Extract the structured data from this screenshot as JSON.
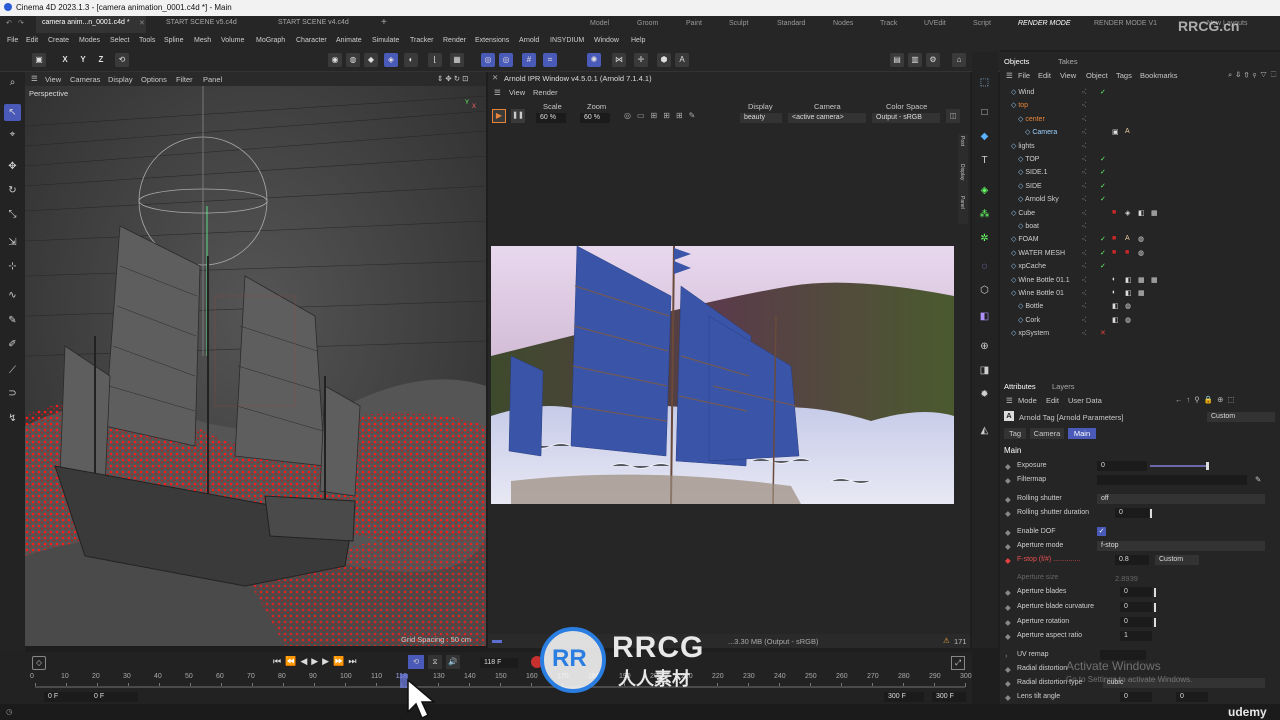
{
  "app": {
    "title": "Cinema 4D 2023.1.3 - [camera animation_0001.c4d *] - Main"
  },
  "tabs": [
    "camera anim...n_0001.c4d *",
    "START SCENE v5.c4d",
    "START SCENE v4.c4d"
  ],
  "layouts": [
    "Model",
    "Groom",
    "Paint",
    "Sculpt",
    "Standard",
    "Nodes",
    "Track",
    "UVEdit",
    "Script",
    "RENDER MODE",
    "RENDER MODE V1"
  ],
  "new_layouts": "New Layouts",
  "menus": [
    "File",
    "Edit",
    "Create",
    "Modes",
    "Select",
    "Tools",
    "Spline",
    "Mesh",
    "Volume",
    "MoGraph",
    "Character",
    "Animate",
    "Simulate",
    "Tracker",
    "Render",
    "Extensions",
    "Arnold",
    "INSYDIUM",
    "Window",
    "Help"
  ],
  "axes": [
    "X",
    "Y",
    "Z"
  ],
  "viewport": {
    "menus": [
      "View",
      "Cameras",
      "Display",
      "Options",
      "Filter",
      "Panel"
    ],
    "label": "Perspective",
    "grid_spacing": "Grid Spacing : 50 cm"
  },
  "ipr": {
    "title": "Arnold IPR Window v4.5.0.1 (Arnold 7.1.4.1)",
    "menus": [
      "View",
      "Render"
    ],
    "scale_label": "Scale",
    "scale": "60 %",
    "zoom_label": "Zoom",
    "zoom": "60 %",
    "display_label": "Display",
    "display": "beauty",
    "camera_label": "Camera",
    "camera": "<active camera>",
    "colorspace_label": "Color Space",
    "colorspace": "Output - sRGB",
    "status": "...3.30 MB (Output - sRGB)",
    "warnings": "171",
    "side_tabs": [
      "Post",
      "Display",
      "Panel"
    ]
  },
  "objects": {
    "tabs": [
      "Objects",
      "Takes"
    ],
    "menus": [
      "File",
      "Edit",
      "View",
      "Object",
      "Tags",
      "Bookmarks"
    ],
    "items": [
      {
        "name": "Wind",
        "indent": 1,
        "color": "#cfcfcf"
      },
      {
        "name": "top",
        "indent": 1,
        "color": "#e8843a"
      },
      {
        "name": "center",
        "indent": 2,
        "color": "#e8843a"
      },
      {
        "name": "Camera",
        "indent": 3,
        "color": "#9ad0ff"
      },
      {
        "name": "lights",
        "indent": 1,
        "color": "#cfcfcf"
      },
      {
        "name": "TOP",
        "indent": 2,
        "color": "#cfcfcf"
      },
      {
        "name": "SIDE.1",
        "indent": 2,
        "color": "#cfcfcf"
      },
      {
        "name": "SIDE",
        "indent": 2,
        "color": "#cfcfcf"
      },
      {
        "name": "Arnold Sky",
        "indent": 2,
        "color": "#cfcfcf"
      },
      {
        "name": "Cube",
        "indent": 1,
        "color": "#cfcfcf"
      },
      {
        "name": "boat",
        "indent": 2,
        "color": "#cfcfcf"
      },
      {
        "name": "FOAM",
        "indent": 1,
        "color": "#cfcfcf"
      },
      {
        "name": "WATER MESH",
        "indent": 1,
        "color": "#cfcfcf"
      },
      {
        "name": "xpCache",
        "indent": 1,
        "color": "#cfcfcf"
      },
      {
        "name": "Wine Bottle 01.1",
        "indent": 1,
        "color": "#cfcfcf"
      },
      {
        "name": "Wine Bottle 01",
        "indent": 1,
        "color": "#cfcfcf"
      },
      {
        "name": "Bottle",
        "indent": 2,
        "color": "#cfcfcf"
      },
      {
        "name": "Cork",
        "indent": 2,
        "color": "#cfcfcf"
      },
      {
        "name": "xpSystem",
        "indent": 1,
        "color": "#cfcfcf"
      }
    ]
  },
  "attributes": {
    "tabs": [
      "Attributes",
      "Layers"
    ],
    "menus": [
      "Mode",
      "Edit",
      "User Data"
    ],
    "header": "Arnold Tag [Arnold Parameters]",
    "preset": "Custom",
    "subtabs": [
      "Tag",
      "Camera",
      "Main"
    ],
    "section": "Main",
    "exposure_label": "Exposure",
    "exposure": "0",
    "filtermap_label": "Filtermap",
    "rolling_label": "Rolling shutter",
    "rolling": "off",
    "rolling_dur_label": "Rolling shutter duration",
    "rolling_dur": "0",
    "dof_label": "Enable DOF",
    "aperture_mode_label": "Aperture mode",
    "aperture_mode": "f-stop",
    "fstop_label": "F-stop (f/#) ..............",
    "fstop": "0.8",
    "fstop_preset": "Custom",
    "aperture_size_label": "Aperture size",
    "aperture_size": "2.8939",
    "blades_label": "Aperture blades",
    "blades": "0",
    "curvature_label": "Aperture blade curvature",
    "curvature": "0",
    "rotation_label": "Aperture rotation",
    "rotation": "0",
    "aspect_label": "Aperture aspect ratio",
    "aspect": "1",
    "uvremap_label": "UV remap",
    "radial1_label": "Radial distortion",
    "radial2_label": "Radial distortion type",
    "radial2": "cubic",
    "tilt_label": "Lens tilt angle",
    "tilt1": "0",
    "tilt2": "0"
  },
  "timeline": {
    "ticks": [
      "0",
      "10",
      "20",
      "30",
      "40",
      "50",
      "60",
      "70",
      "80",
      "90",
      "100",
      "110",
      "118",
      "130",
      "140",
      "150",
      "160",
      "170",
      "180",
      "190",
      "200",
      "210",
      "220",
      "230",
      "240",
      "250",
      "260",
      "270",
      "280",
      "290",
      "300"
    ],
    "current": "118 F",
    "start1": "0 F",
    "start2": "0 F",
    "end1": "300 F",
    "end2": "300 F"
  },
  "watermark": {
    "activate": "Activate Windows",
    "activate_sub": "Go to Settings to activate Windows.",
    "rrcg": "RRCG",
    "rrcg_sub": "人人素材",
    "udemy": "udemy",
    "corner": "RRCG.cn"
  }
}
